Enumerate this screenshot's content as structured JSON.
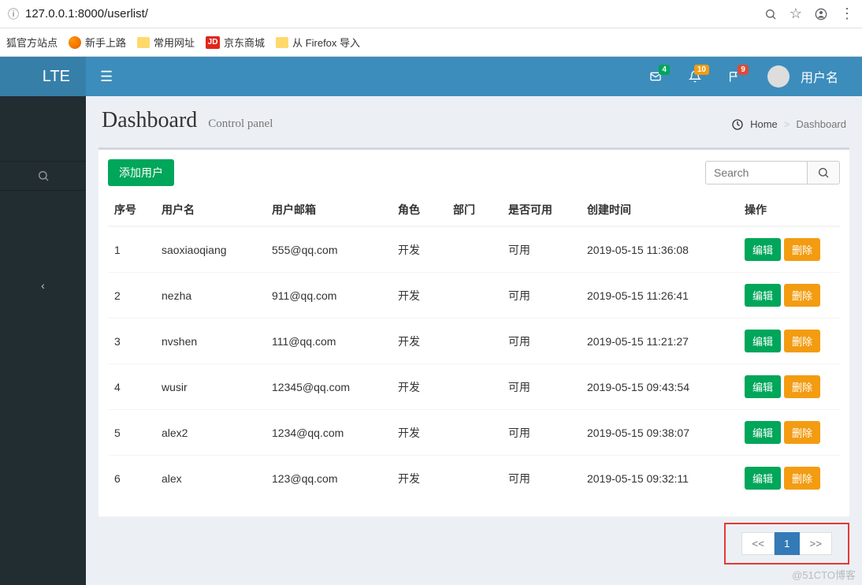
{
  "browser": {
    "url": "127.0.0.1:8000/userlist/"
  },
  "bookmarks": [
    {
      "label": "狐官方站点",
      "icon": "folder"
    },
    {
      "label": "新手上路",
      "icon": "firefox"
    },
    {
      "label": "常用网址",
      "icon": "folder"
    },
    {
      "label": "京东商城",
      "icon": "jd"
    },
    {
      "label": "从 Firefox 导入",
      "icon": "folder"
    }
  ],
  "header": {
    "logo": "LTE",
    "badges": {
      "mail": "4",
      "bell": "10",
      "flag": "9"
    },
    "username": "用户名"
  },
  "page": {
    "title": "Dashboard",
    "subtitle": "Control panel",
    "breadcrumb_home": "Home",
    "breadcrumb_current": "Dashboard"
  },
  "box": {
    "add_user": "添加用户",
    "search_placeholder": "Search",
    "edit_label": "编辑",
    "delete_label": "删除"
  },
  "table": {
    "headers": [
      "序号",
      "用户名",
      "用户邮箱",
      "角色",
      "部门",
      "是否可用",
      "创建时间",
      "操作"
    ],
    "rows": [
      {
        "id": "1",
        "username": "saoxiaoqiang",
        "email": "555@qq.com",
        "role": "开发",
        "dept": "",
        "usable": "可用",
        "created": "2019-05-15 11:36:08"
      },
      {
        "id": "2",
        "username": "nezha",
        "email": "911@qq.com",
        "role": "开发",
        "dept": "",
        "usable": "可用",
        "created": "2019-05-15 11:26:41"
      },
      {
        "id": "3",
        "username": "nvshen",
        "email": "111@qq.com",
        "role": "开发",
        "dept": "",
        "usable": "可用",
        "created": "2019-05-15 11:21:27"
      },
      {
        "id": "4",
        "username": "wusir",
        "email": "12345@qq.com",
        "role": "开发",
        "dept": "",
        "usable": "可用",
        "created": "2019-05-15 09:43:54"
      },
      {
        "id": "5",
        "username": "alex2",
        "email": "1234@qq.com",
        "role": "开发",
        "dept": "",
        "usable": "可用",
        "created": "2019-05-15 09:38:07"
      },
      {
        "id": "6",
        "username": "alex",
        "email": "123@qq.com",
        "role": "开发",
        "dept": "",
        "usable": "可用",
        "created": "2019-05-15 09:32:11"
      }
    ]
  },
  "pagination": {
    "prev": "<<",
    "current": "1",
    "next": ">>"
  },
  "watermark": "@51CTO博客"
}
